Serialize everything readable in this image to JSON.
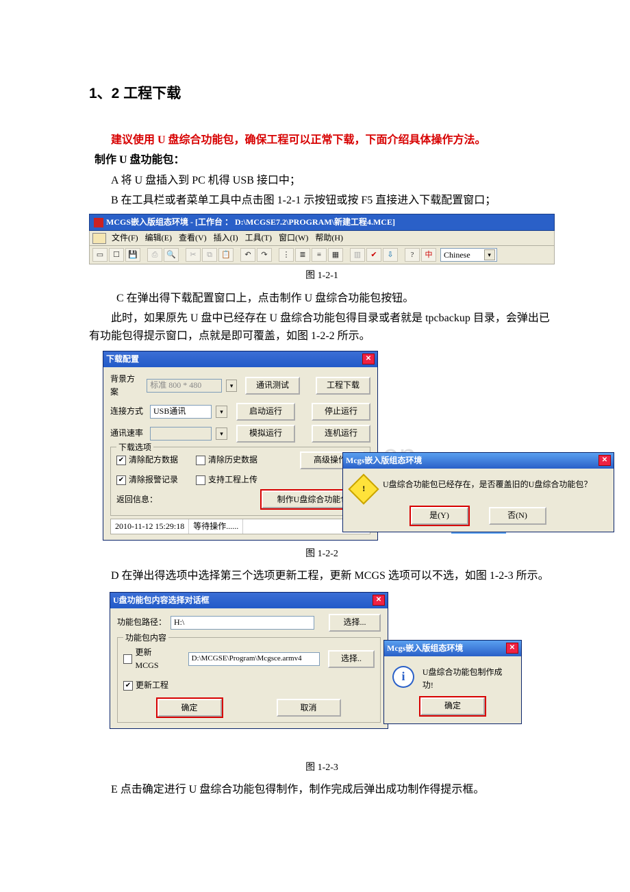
{
  "heading": "1、2 工程下载",
  "p_red": "建议使用 U 盘综合功能包，确保工程可以正常下载，下面介绍具体操作方法。",
  "p_make": "制作 U 盘功能包：",
  "step_A": "A  将 U 盘插入到 PC 机得 USB 接口中；",
  "step_B": "B  在工具栏或者菜单工具中点击图 1-2-1 示按钮或按 F5 直接进入下载配置窗口；",
  "fig1": {
    "title": "MCGS嵌入版组态环境 - [工作台 ： D:\\MCGSE7.2\\PROGRAM\\新建工程4.MCE]",
    "menus": [
      "文件(F)",
      "编辑(E)",
      "查看(V)",
      "插入(I)",
      "工具(T)",
      "窗口(W)",
      "帮助(H)"
    ],
    "combo": "Chinese",
    "caption": "图 1-2-1"
  },
  "step_C": "C  在弹出得下载配置窗口上，点击制作 U 盘综合功能包按钮。",
  "para_C2": "此时，如果原先 U 盘中已经存在 U 盘综合功能包得目录或者就是 tpcbackup 目录，会弹出已有功能包得提示窗口，点就是即可覆盖，如图 1-2-2 所示。",
  "fig2": {
    "dlg1_title": "下载配置",
    "lbl_bg": "背景方案",
    "val_bg": "标准 800 * 480",
    "btn_commtest": "通讯测试",
    "btn_projdl": "工程下载",
    "lbl_conn": "连接方式",
    "val_conn": "USB通讯",
    "btn_start": "启动运行",
    "btn_stop": "停止运行",
    "lbl_rate": "通讯速率",
    "btn_sim": "模拟运行",
    "btn_online": "连机运行",
    "grp_title": "下载选项",
    "cb1": "清除配方数据",
    "cb2": "清除历史数据",
    "btn_advance": "高级操作..",
    "cb3": "清除报警记录",
    "cb4": "支持工程上传",
    "btn_makeusb": "制作U盘综合功能包",
    "lbl_return": "返回信息：",
    "status_time": "2010-11-12 15:29:18",
    "status_text": "等待操作......",
    "dlg2_title": "Mcgs嵌入版组态环境",
    "dlg2_msg": "U盘综合功能包已经存在，是否覆盖旧的U盘综合功能包？",
    "btn_yes": "是(Y)",
    "btn_no": "否(N)",
    "caption": "图 1-2-2",
    "watermark": "www.yixin.com.cn"
  },
  "step_D": "D  在弹出得选项中选择第三个选项更新工程，更新 MCGS 选项可以不选，如图 1-2-3 所示。",
  "fig3": {
    "dlgA_title": "U盘功能包内容选择对话框",
    "lbl_path": "功能包路径：",
    "val_path": "H:\\",
    "btn_select": "选择...",
    "grp_title": "功能包内容",
    "cb_updmcgs": "更新MCGS",
    "val_updmcgs": "D:\\MCGSE\\Program\\Mcgsce.armv4",
    "btn_select2": "选择..",
    "cb_updproj": "更新工程",
    "btn_ok": "确定",
    "btn_cancel": "取消",
    "dlgB_title": "Mcgs嵌入版组态环境",
    "dlgB_msg": "U盘综合功能包制作成功!",
    "btn_ok2": "确定",
    "caption": "图 1-2-3"
  },
  "step_E": "E  点击确定进行 U 盘综合功能包得制作，制作完成后弹出成功制作得提示框。"
}
